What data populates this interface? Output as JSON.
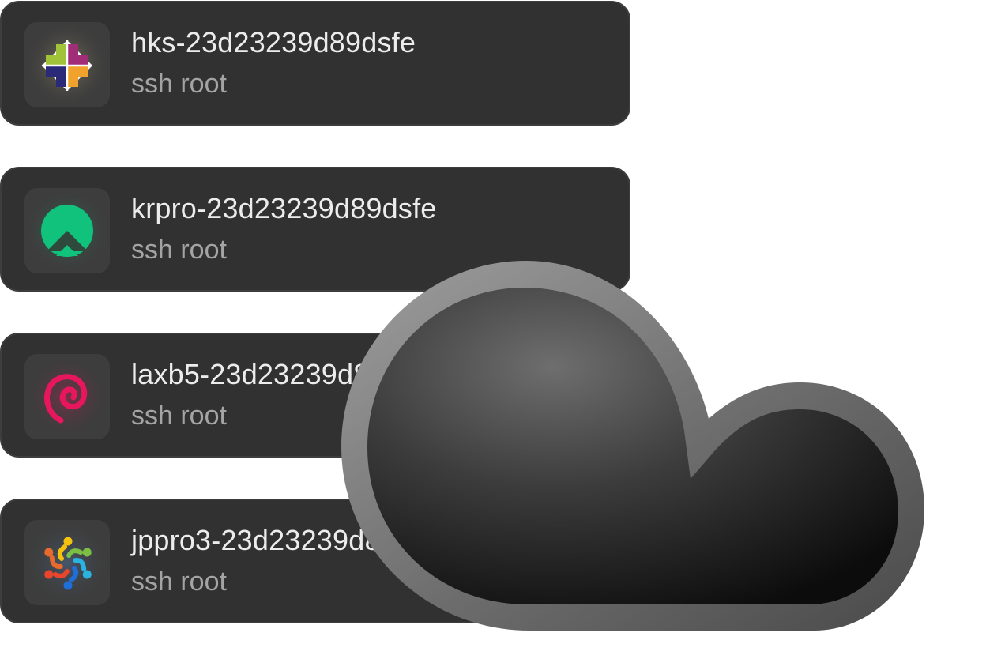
{
  "servers": [
    {
      "hostname": "hks-23d23239d89dsfe",
      "command": "ssh root",
      "os_icon": "centos-icon",
      "glow_color": "#d9c58b"
    },
    {
      "hostname": "krpro-23d23239d89dsfe",
      "command": "ssh root",
      "os_icon": "rocky-linux-icon",
      "accent_color": "#10c27c"
    },
    {
      "hostname": "laxb5-23d23239d89dsfe",
      "command": "ssh root",
      "os_icon": "debian-icon",
      "accent_color": "#e8175d"
    },
    {
      "hostname": "jppro3-23d23239d89dsfe",
      "command": "ssh root",
      "os_icon": "edubuntu-icon"
    }
  ],
  "overlay": {
    "icon": "cloud-icon",
    "fill_color": "#2e2e2e",
    "outline_color": "#7a7a7a"
  }
}
